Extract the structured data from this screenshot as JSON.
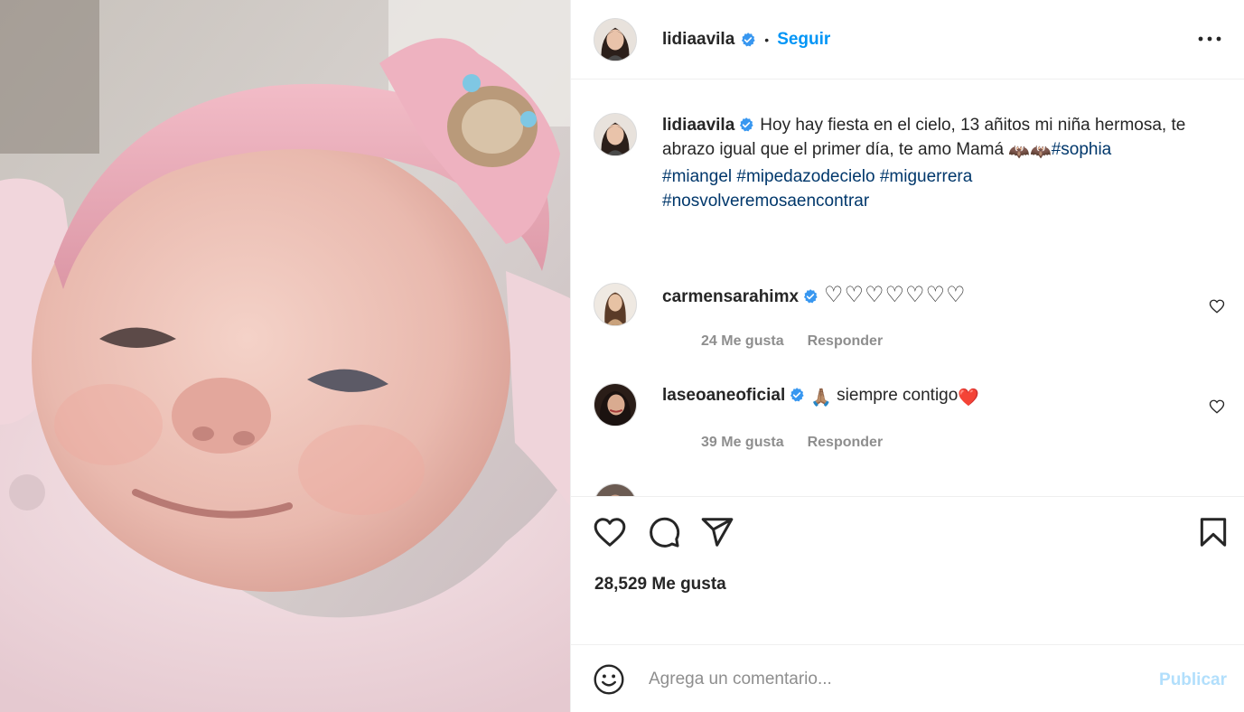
{
  "post": {
    "author": "lidiaavila",
    "follow_label": "Seguir",
    "separator": "•",
    "caption_text": "Hoy hay fiesta en el cielo, 13 añitos mi niña hermosa, te abrazo igual que el primer día, te amo Mamá ",
    "caption_emoji": "🦇🦇",
    "hashtags": [
      "#sophia",
      "#miangel",
      "#mipedazodecielo",
      "#miguerrera",
      "#nosvolveremosaencontrar"
    ],
    "likes_text": "28,529 Me gusta"
  },
  "comments": [
    {
      "username": "carmensarahimx",
      "text": "",
      "hearts": "♡♡♡♡♡♡♡",
      "likes": "24 Me gusta",
      "reply": "Responder"
    },
    {
      "username": "laseoaneoficial",
      "text": " siempre contigo",
      "emoji_before": "🙏🏽",
      "emoji_after": "❤️",
      "likes": "39 Me gusta",
      "reply": "Responder"
    }
  ],
  "composer": {
    "placeholder": "Agrega un comentario...",
    "publish_label": "Publicar"
  },
  "icons": {
    "verified": "verified-badge-icon",
    "more": "more-options-icon",
    "like": "heart-icon",
    "comment": "comment-icon",
    "share": "share-icon",
    "save": "bookmark-icon",
    "emoji": "emoji-icon"
  },
  "colors": {
    "accent": "#0095f6",
    "hashtag": "#00376b",
    "muted": "#8e8e8e",
    "publish_disabled": "#b2dffc",
    "verified": "#3897f0"
  }
}
